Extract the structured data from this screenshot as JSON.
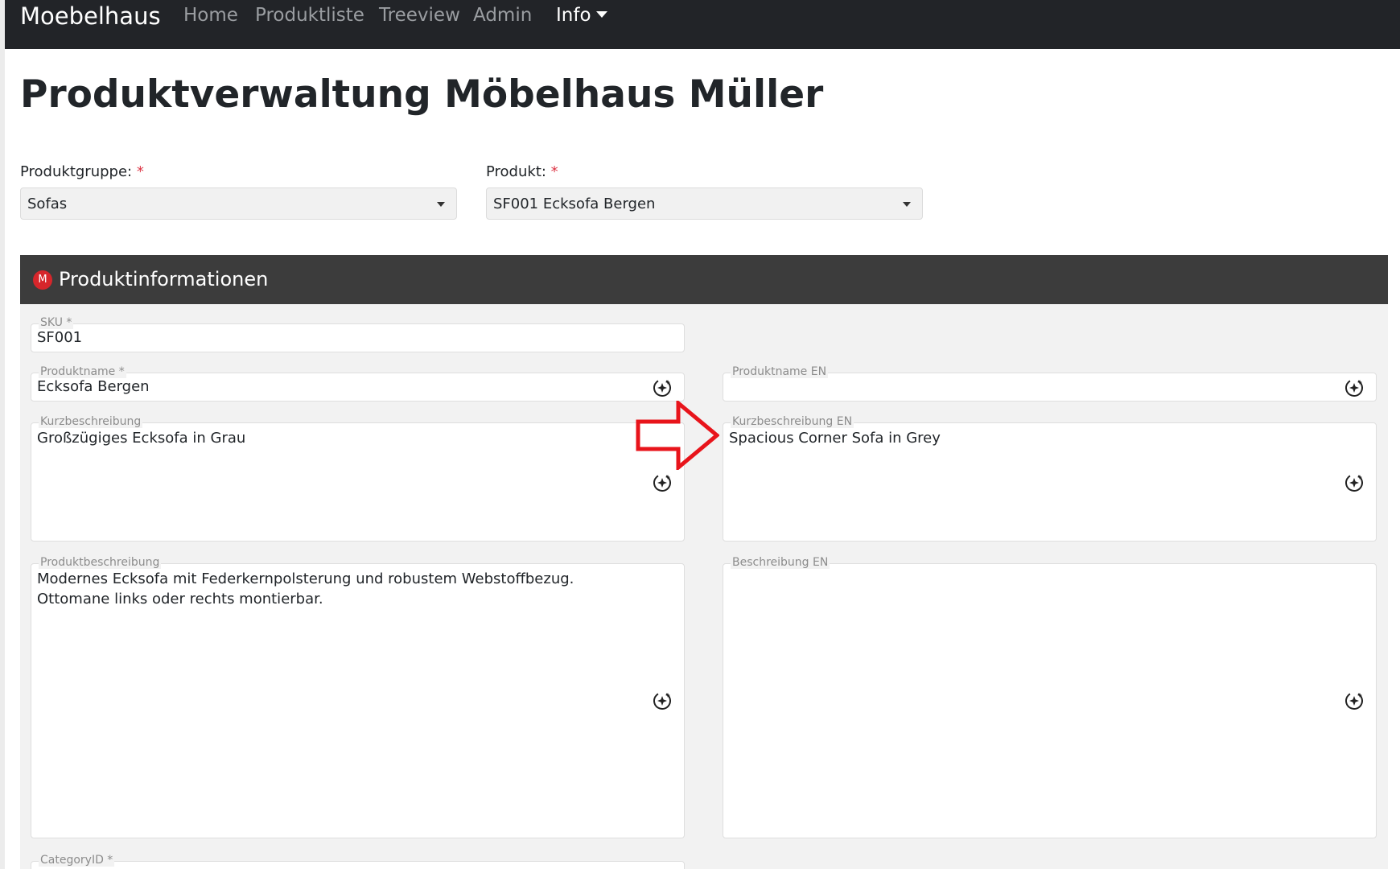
{
  "navbar": {
    "brand": "Moebelhaus",
    "links": [
      "Home",
      "Produktliste",
      "Treeview",
      "Admin"
    ],
    "info": "Info"
  },
  "page_title": "Produktverwaltung Möbelhaus Müller",
  "filters": {
    "group_label": "Produktgruppe:",
    "group_value": "Sofas",
    "product_label": "Produkt:",
    "product_value": "SF001 Ecksofa Bergen",
    "required_marker": "*"
  },
  "panel": {
    "logo_text": "M",
    "title": "Produktinformationen"
  },
  "fields": {
    "sku": {
      "label": "SKU *",
      "value": "SF001"
    },
    "name": {
      "label": "Produktname *",
      "value": "Ecksofa Bergen"
    },
    "name_en": {
      "label": "Produktname EN",
      "value": ""
    },
    "short": {
      "label": "Kurzbeschreibung",
      "value": "Großzügiges Ecksofa in Grau"
    },
    "short_en": {
      "label": "Kurzbeschreibung EN",
      "value": "Spacious Corner Sofa in Grey"
    },
    "desc": {
      "label": "Produktbeschreibung",
      "value": "Modernes Ecksofa mit Federkernpolsterung und robustem Webstoffbezug. Ottomane links oder rechts montierbar."
    },
    "desc_en": {
      "label": "Beschreibung EN",
      "value": ""
    },
    "category": {
      "label": "CategoryID *",
      "value": ""
    }
  },
  "colors": {
    "navbar": "#222428",
    "panel_header": "#3c3c3c",
    "panel_body": "#f2f2f2",
    "required": "#dc3545",
    "annotation_arrow": "#e8141b"
  },
  "icons": {
    "field_action": "sparkle-plus-icon",
    "annotation": "right-arrow-annotation"
  }
}
